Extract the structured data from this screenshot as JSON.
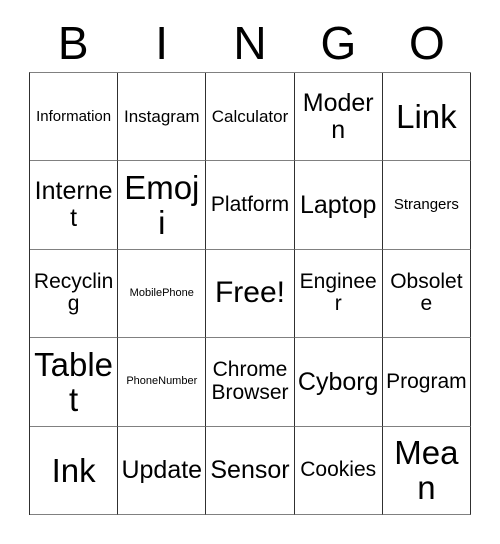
{
  "card": {
    "title": "Bingo Card",
    "header_letters": [
      "B",
      "I",
      "N",
      "G",
      "O"
    ],
    "columns": 5,
    "rows": 5,
    "free_space": "Free!",
    "free_space_position": {
      "row": 3,
      "column": 3
    },
    "colors": {
      "background": "#ffffff",
      "text": "#000000",
      "grid_line": "#303030",
      "grid_line_light": "#808080"
    },
    "cells": [
      [
        {
          "label": "Information",
          "size": "fs-xs"
        },
        {
          "label": "Instagram",
          "size": "fs-sm"
        },
        {
          "label": "Calculator",
          "size": "fs-sm"
        },
        {
          "label": "Modern",
          "size": "fs-lg"
        },
        {
          "label": "Link",
          "size": "fs-xxl"
        }
      ],
      [
        {
          "label": "Internet",
          "size": "fs-lg"
        },
        {
          "label": "Emoji",
          "size": "fs-xxl"
        },
        {
          "label": "Platform",
          "size": "fs-md"
        },
        {
          "label": "Laptop",
          "size": "fs-lg"
        },
        {
          "label": "Strangers",
          "size": "fs-xs"
        }
      ],
      [
        {
          "label": "Recycling",
          "size": "fs-md"
        },
        {
          "label": "MobilePhone",
          "size": "fs-xxs"
        },
        {
          "label": "Free!",
          "size": "fs-xl"
        },
        {
          "label": "Engineer",
          "size": "fs-md"
        },
        {
          "label": "Obsolete",
          "size": "fs-md"
        }
      ],
      [
        {
          "label": "Tablet",
          "size": "fs-xxl"
        },
        {
          "label": "PhoneNumber",
          "size": "fs-xxs"
        },
        {
          "label": "Chrome Browser",
          "size": "fs-md"
        },
        {
          "label": "Cyborg",
          "size": "fs-lg"
        },
        {
          "label": "Program",
          "size": "fs-md"
        }
      ],
      [
        {
          "label": "Ink",
          "size": "fs-xxl"
        },
        {
          "label": "Update",
          "size": "fs-lg"
        },
        {
          "label": "Sensor",
          "size": "fs-lg"
        },
        {
          "label": "Cookies",
          "size": "fs-md"
        },
        {
          "label": "Mean",
          "size": "fs-xxl"
        }
      ]
    ]
  }
}
